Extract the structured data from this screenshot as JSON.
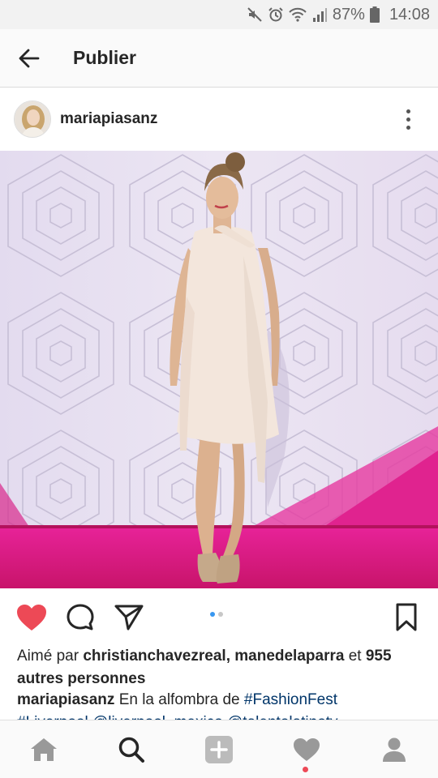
{
  "status_bar": {
    "battery_percent": "87%",
    "time": "14:08",
    "icons": [
      "mute-icon",
      "alarm-icon",
      "wifi-icon",
      "signal-icon",
      "battery-icon"
    ]
  },
  "header": {
    "title": "Publier",
    "back_icon": "arrow-left-icon"
  },
  "post": {
    "username": "mariapiasanz",
    "more_icon": "more-vertical-icon",
    "image_description_colors": {
      "wall": "#e4dcf0",
      "floor": "#c8145e",
      "accent_pink": "#e0208a",
      "dress": "#f2e4da"
    },
    "carousel": {
      "count": 2,
      "active": 1
    },
    "actions": {
      "like_icon": "heart-filled-icon",
      "comment_icon": "comment-icon",
      "share_icon": "send-icon",
      "save_icon": "bookmark-icon",
      "liked": true,
      "like_color": "#ed4956"
    },
    "likes": {
      "prefix": "Aimé par",
      "user1": "christianchavezreal",
      "separator": ",",
      "user2": "manedelaparra",
      "and": "et",
      "count": "955",
      "suffix": "autres personnes"
    },
    "caption": {
      "username": "mariapiasanz",
      "text": "En la alfombra de",
      "hashtag1": "#FashionFest",
      "line2": "#Liverpool @liverpool_mexico @talentolatinotv"
    }
  },
  "bottom_nav": {
    "items": [
      "home-icon",
      "search-icon",
      "add-post-icon",
      "activity-heart-icon",
      "profile-icon"
    ],
    "active": "search-icon",
    "has_notification": true
  }
}
